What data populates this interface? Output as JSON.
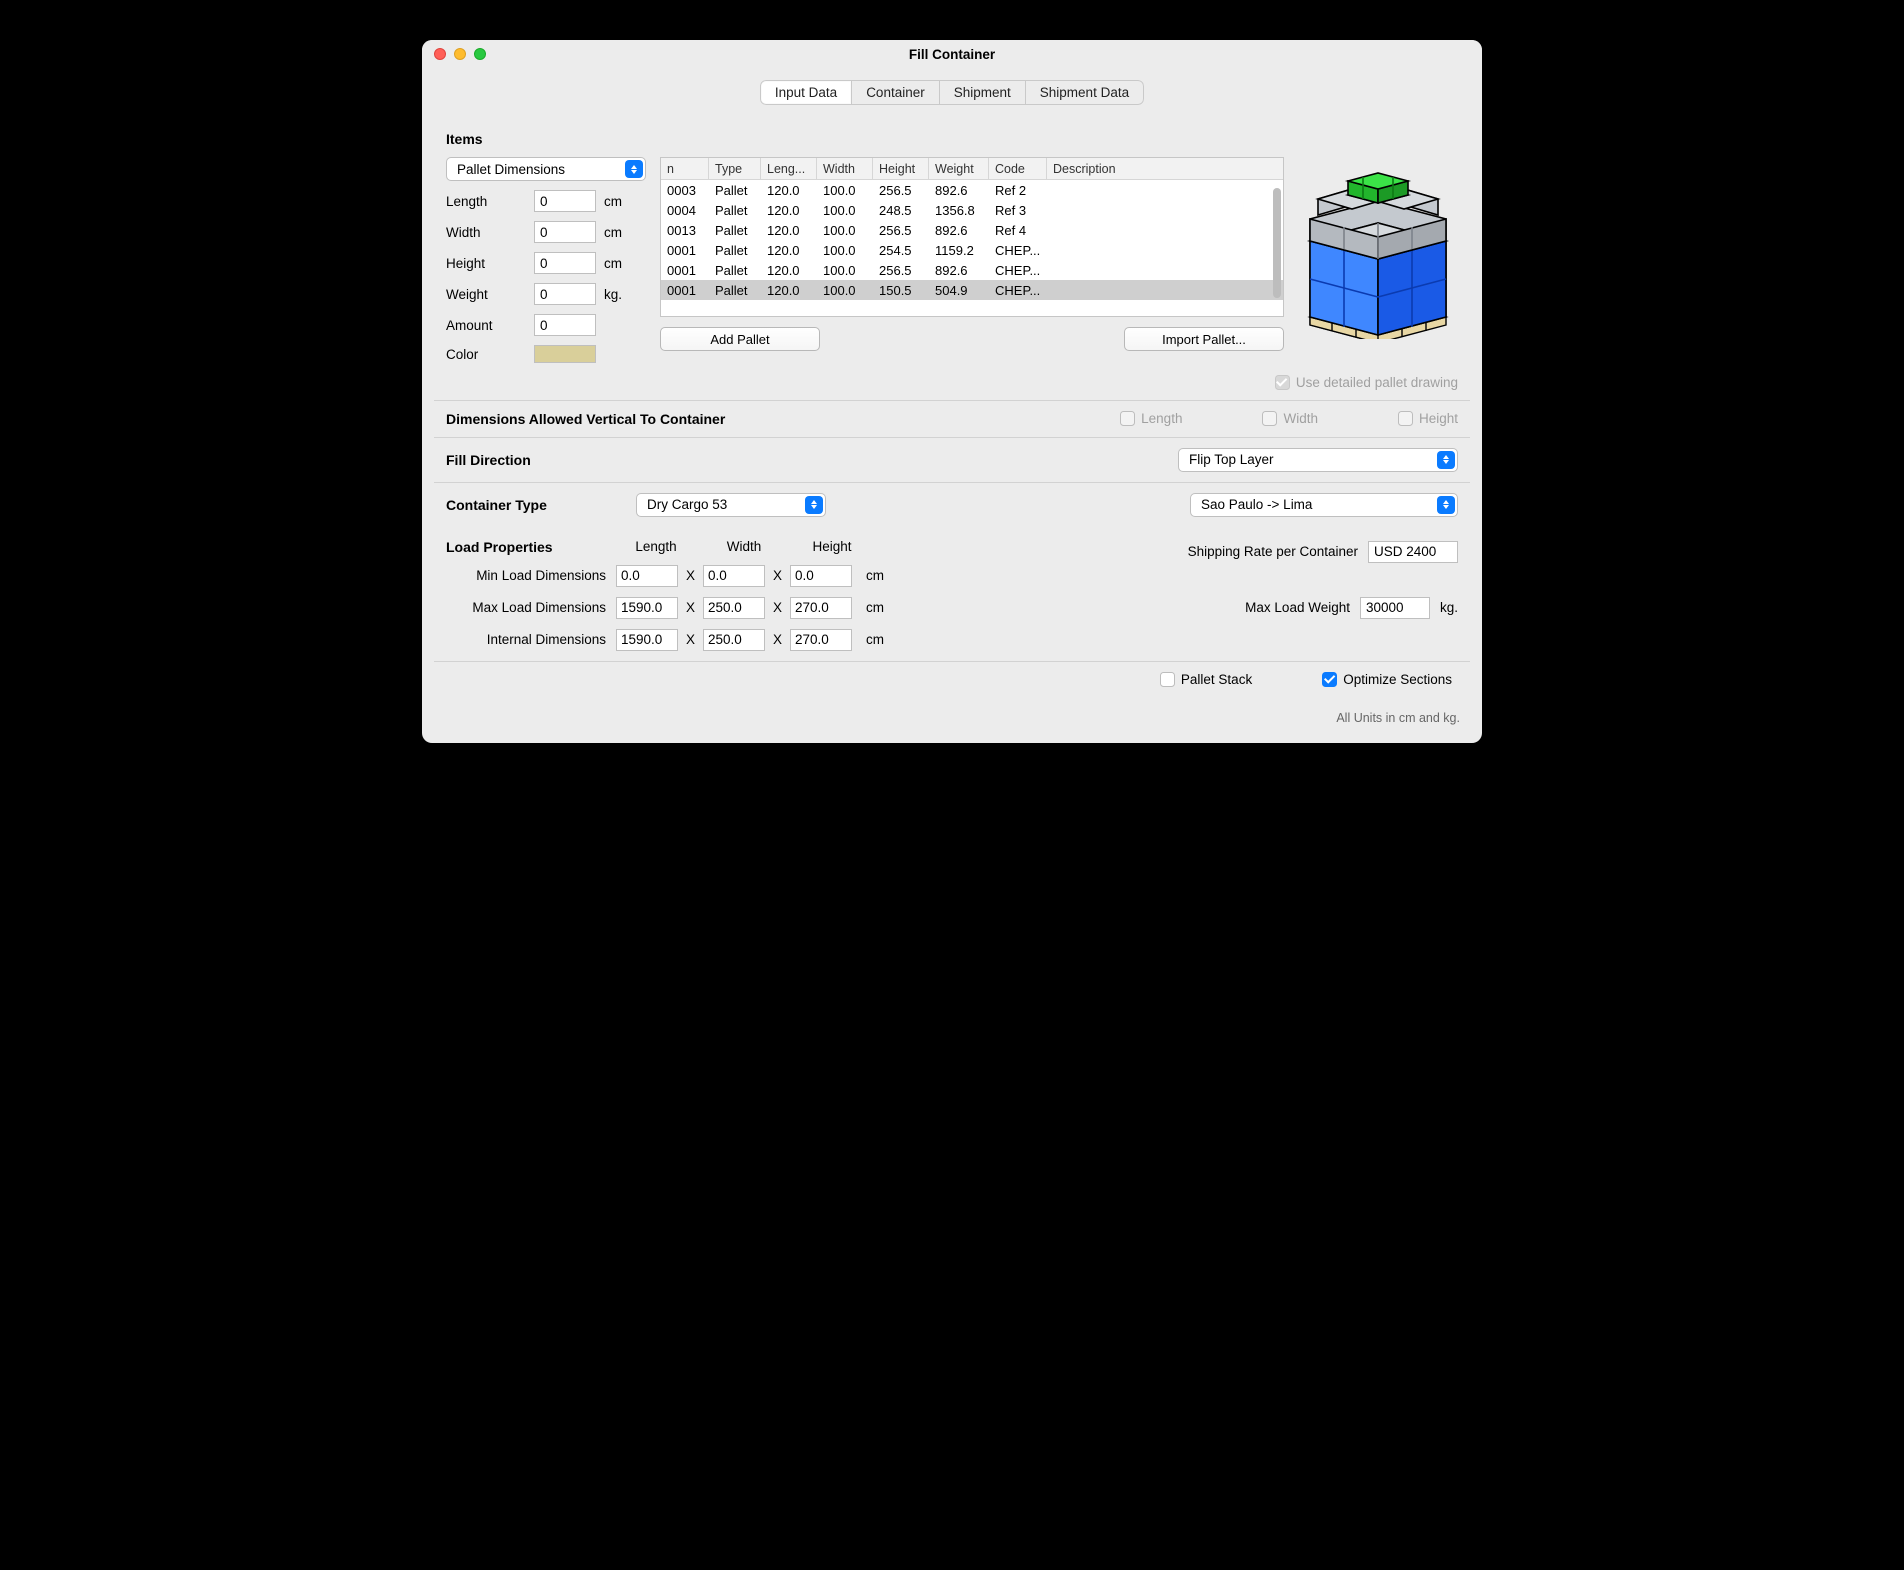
{
  "window": {
    "title": "Fill Container"
  },
  "tabs": [
    "Input Data",
    "Container",
    "Shipment",
    "Shipment Data"
  ],
  "items": {
    "title": "Items",
    "mode_select": "Pallet Dimensions",
    "fields": {
      "length_label": "Length",
      "length_value": "0",
      "length_unit": "cm",
      "width_label": "Width",
      "width_value": "0",
      "width_unit": "cm",
      "height_label": "Height",
      "height_value": "0",
      "height_unit": "cm",
      "weight_label": "Weight",
      "weight_value": "0",
      "weight_unit": "kg.",
      "amount_label": "Amount",
      "amount_value": "0",
      "color_label": "Color"
    },
    "table": {
      "headers": {
        "n": "n",
        "type": "Type",
        "length": "Leng...",
        "width": "Width",
        "height": "Height",
        "weight": "Weight",
        "code": "Code",
        "desc": "Description"
      },
      "rows": [
        {
          "n": "0003",
          "type": "Pallet",
          "length": "120.0",
          "width": "100.0",
          "height": "256.5",
          "weight": "892.6",
          "code": "Ref 2",
          "desc": ""
        },
        {
          "n": "0004",
          "type": "Pallet",
          "length": "120.0",
          "width": "100.0",
          "height": "248.5",
          "weight": "1356.8",
          "code": "Ref 3",
          "desc": ""
        },
        {
          "n": "0013",
          "type": "Pallet",
          "length": "120.0",
          "width": "100.0",
          "height": "256.5",
          "weight": "892.6",
          "code": "Ref 4",
          "desc": ""
        },
        {
          "n": "0001",
          "type": "Pallet",
          "length": "120.0",
          "width": "100.0",
          "height": "254.5",
          "weight": "1159.2",
          "code": "CHEP...",
          "desc": ""
        },
        {
          "n": "0001",
          "type": "Pallet",
          "length": "120.0",
          "width": "100.0",
          "height": "256.5",
          "weight": "892.6",
          "code": "CHEP...",
          "desc": ""
        },
        {
          "n": "0001",
          "type": "Pallet",
          "length": "120.0",
          "width": "100.0",
          "height": "150.5",
          "weight": "504.9",
          "code": "CHEP...",
          "desc": "",
          "selected": true
        }
      ]
    },
    "buttons": {
      "add": "Add Pallet",
      "import": "Import Pallet..."
    },
    "detailed_label": "Use detailed pallet drawing"
  },
  "dimensions_allowed": {
    "title": "Dimensions Allowed Vertical To Container",
    "length": "Length",
    "width": "Width",
    "height": "Height"
  },
  "fill_direction": {
    "title": "Fill Direction",
    "value": "Flip Top Layer"
  },
  "container": {
    "type_label": "Container Type",
    "type_value": "Dry Cargo 53",
    "route_value": "Sao Paulo -> Lima",
    "load_label": "Load Properties",
    "hdr_length": "Length",
    "hdr_width": "Width",
    "hdr_height": "Height",
    "min_label": "Min Load Dimensions",
    "min": {
      "l": "0.0",
      "w": "0.0",
      "h": "0.0"
    },
    "min_unit": "cm",
    "max_label": "Max Load Dimensions",
    "max": {
      "l": "1590.0",
      "w": "250.0",
      "h": "270.0"
    },
    "max_unit": "cm",
    "int_label": "Internal Dimensions",
    "int": {
      "l": "1590.0",
      "w": "250.0",
      "h": "270.0"
    },
    "int_unit": "cm",
    "rate_label": "Shipping Rate per Container",
    "rate_value": "USD 2400",
    "maxw_label": "Max Load Weight",
    "maxw_value": "30000",
    "maxw_unit": "kg."
  },
  "opts": {
    "pallet_stack": "Pallet Stack",
    "optimize": "Optimize Sections"
  },
  "footer": "All Units in cm and kg."
}
